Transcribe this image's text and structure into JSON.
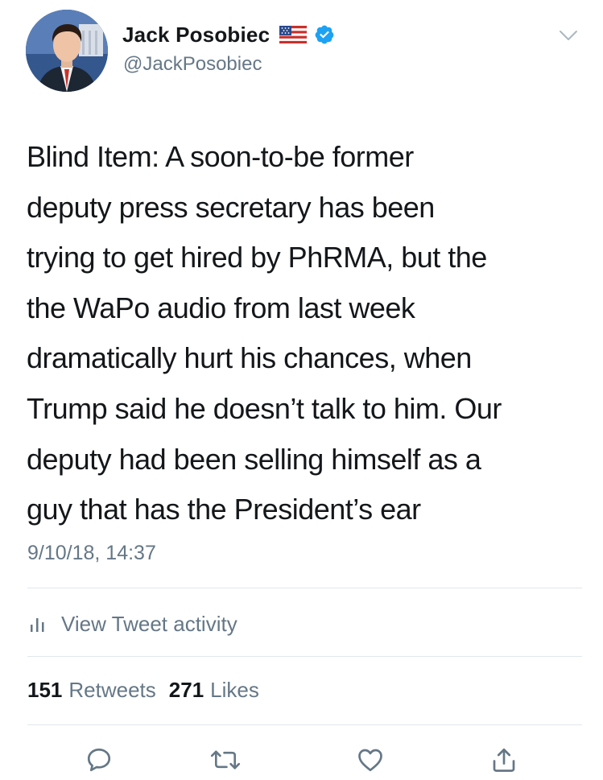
{
  "tweet": {
    "author": {
      "display_name": "Jack Posobiec",
      "handle": "@JackPosobiec",
      "flag_icon": "us-flag-icon",
      "verified_icon": "verified-badge-icon",
      "verified_color": "#1da1f2"
    },
    "text": "Blind Item: A soon-to-be former\ndeputy press secretary has been\ntrying to get hired by PhRMA, but the\nthe WaPo audio from last week\ndramatically hurt his chances, when\nTrump said he doesn’t talk to him. Our\ndeputy had been selling himself as a\nguy that has the President’s ear",
    "timestamp": "9/10/18, 14:37",
    "activity_label": "View Tweet activity",
    "stats": {
      "retweets_count": "151",
      "retweets_label": "Retweets",
      "likes_count": "271",
      "likes_label": "Likes"
    },
    "actions": [
      "reply-icon",
      "retweet-icon",
      "like-icon",
      "share-icon"
    ]
  },
  "colors": {
    "text_primary": "#14171a",
    "text_secondary": "#657786",
    "divider": "#e1e8ed",
    "brand_blue": "#1da1f2"
  }
}
